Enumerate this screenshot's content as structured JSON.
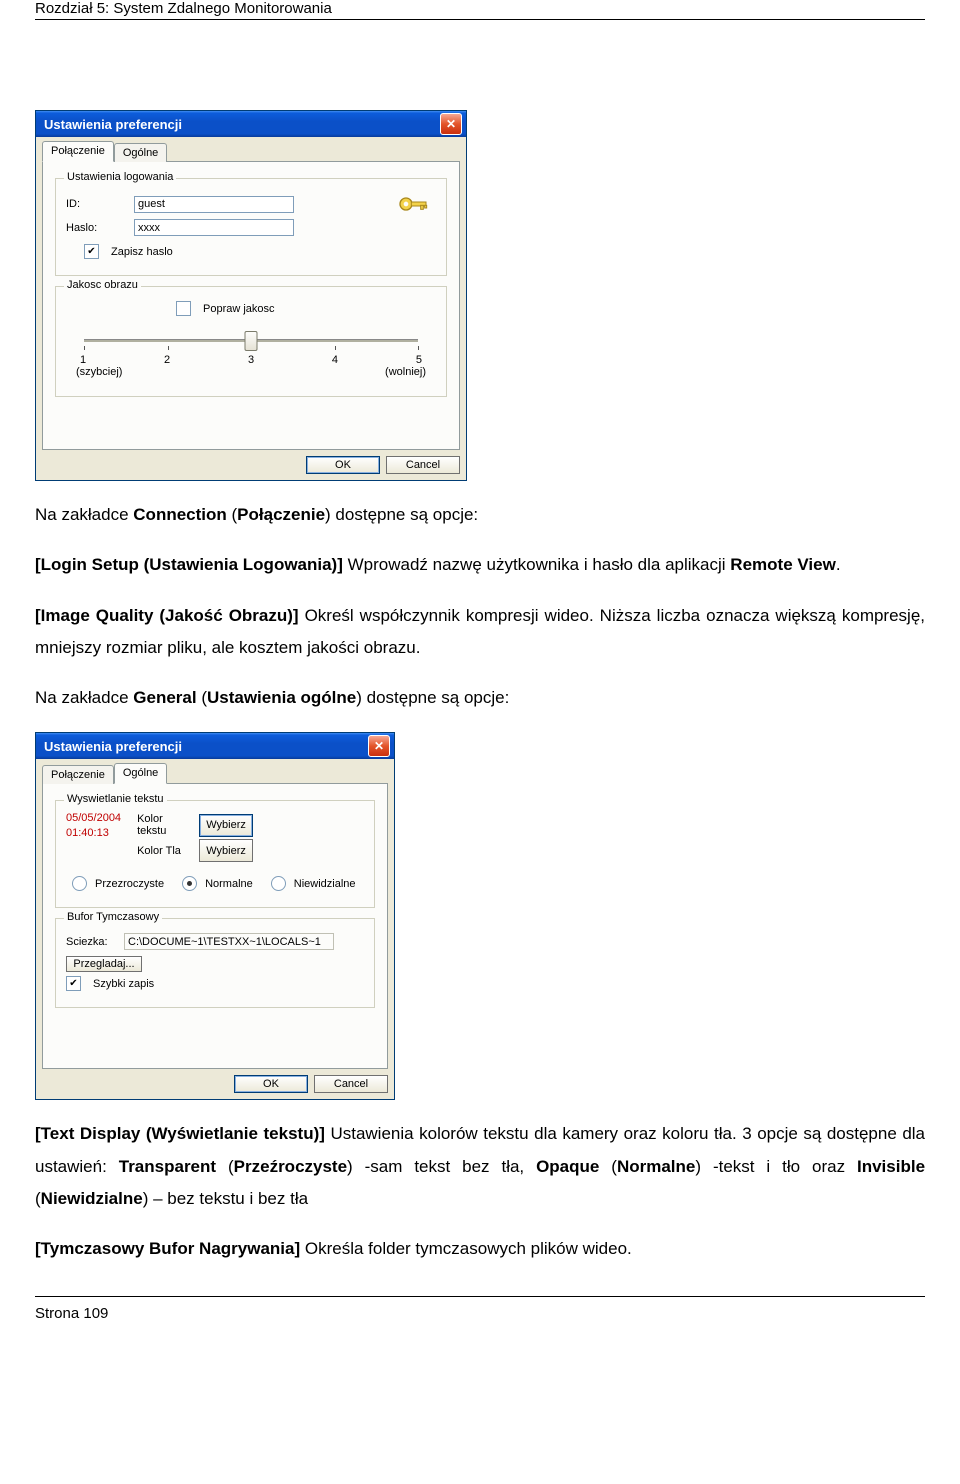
{
  "doc": {
    "header": "Rozdział 5: System Zdalnego Monitorowania",
    "footer": "Strona 109",
    "p1a": "Na zakładce ",
    "p1b": "Connection",
    "p1c": " (",
    "p1d": "Połączenie",
    "p1e": ") dostępne są opcje:",
    "p2a": "[Login Setup (Ustawienia Logowania)]",
    "p2b": "   Wprowadź nazwę użytkownika i hasło dla aplikacji ",
    "p2c": "Remote View",
    "p2d": ".",
    "p3a": "[Image Quality (Jakość Obrazu)]",
    "p3b": "   Określ współczynnik kompresji wideo. Niższa liczba oznacza większą kompresję, mniejszy rozmiar pliku, ale kosztem jakości obrazu.",
    "p4a": "Na zakładce ",
    "p4b": "General",
    "p4c": " (",
    "p4d": "Ustawienia ogólne",
    "p4e": ") dostępne są opcje:",
    "p5a": "[Text Display (Wyświetlanie tekstu)]",
    "p5b": "   Ustawienia kolorów tekstu dla kamery oraz koloru tła. 3 opcje są dostępne dla ustawień: ",
    "p5c": "Transparent",
    "p5d": " (",
    "p5e": "Przeźroczyste",
    "p5f": ") -sam tekst bez tła, ",
    "p5g": "Opaque",
    "p5h": " (",
    "p5i": "Normalne",
    "p5j": ") -tekst i tło oraz ",
    "p5k": "Invisible",
    "p5l": " (",
    "p5m": "Niewidzialne",
    "p5n": ") – bez tekstu i bez tła",
    "p6a": "[Tymczasowy Bufor Nagrywania]",
    "p6b": "   Określa folder tymczasowych plików wideo."
  },
  "dlg1": {
    "title": "Ustawienia preferencji",
    "tab_conn": "Połączenie",
    "tab_gen": "Ogólne",
    "login_legend": "Ustawienia logowania",
    "id_label": "ID:",
    "id_value": "guest",
    "pw_label": "Haslo:",
    "pw_value": "xxxx",
    "save_pw": "Zapisz haslo",
    "quality_legend": "Jakosc obrazu",
    "improve": "Popraw jakosc",
    "n1": "1",
    "n2": "2",
    "n3": "3",
    "n4": "4",
    "n5": "5",
    "fast": "(szybciej)",
    "slow": "(wolniej)",
    "ok": "OK",
    "cancel": "Cancel"
  },
  "dlg2": {
    "title": "Ustawienia preferencji",
    "tab_conn": "Połączenie",
    "tab_gen": "Ogólne",
    "text_legend": "Wyswietlanie tekstu",
    "date": "05/05/2004",
    "time": "01:40:13",
    "kt": "Kolor tekstu",
    "kb": "Kolor Tla",
    "choose": "Wybierz",
    "r1": "Przezroczyste",
    "r2": "Normalne",
    "r3": "Niewidzialne",
    "buf_legend": "Bufor Tymczasowy",
    "path_label": "Sciezka:",
    "path_value": "C:\\DOCUME~1\\TESTXX~1\\LOCALS~1",
    "browse": "Przegladaj...",
    "fast_write": "Szybki zapis",
    "ok": "OK",
    "cancel": "Cancel"
  }
}
